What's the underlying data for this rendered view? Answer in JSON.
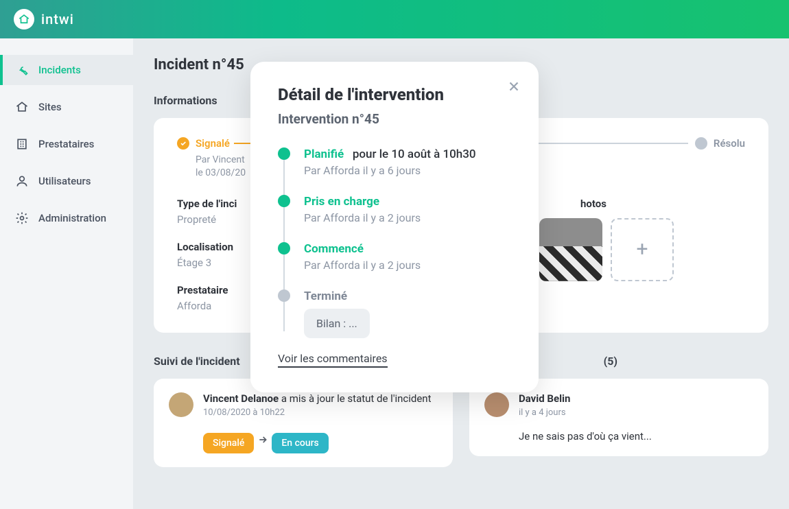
{
  "app": {
    "brand": "intwi"
  },
  "sidebar": {
    "items": [
      {
        "label": "Incidents",
        "icon": "wrench-icon",
        "active": true
      },
      {
        "label": "Sites",
        "icon": "home-icon",
        "active": false
      },
      {
        "label": "Prestataires",
        "icon": "building-icon",
        "active": false
      },
      {
        "label": "Utilisateurs",
        "icon": "user-icon",
        "active": false
      },
      {
        "label": "Administration",
        "icon": "gear-icon",
        "active": false
      }
    ]
  },
  "page": {
    "title": "Incident n°45",
    "informations_heading": "Informations"
  },
  "stepper": {
    "step1": {
      "label": "Signalé",
      "sub1": "Par Vincent",
      "sub2": "le 03/08/20"
    },
    "step_last": {
      "label": "Résolu"
    }
  },
  "info": {
    "type_label": "Type de l'inci",
    "type_value": "Propreté",
    "localisation_label": "Localisation",
    "localisation_value": "Étage 3",
    "prestataire_label": "Prestataire",
    "prestataire_value": "Afforda",
    "photos_label": "hotos"
  },
  "suivi": {
    "heading": "Suivi de l'incident",
    "actor": "Vincent Delanoe",
    "action": " a mis à jour le statut de l'incident",
    "time": "10/08/2020 à 10h22",
    "from": "Signalé",
    "to": "En cours"
  },
  "comments": {
    "heading": "(5)",
    "author": "David Belin",
    "time": "il y a 4 jours",
    "body": "Je ne sais pas d'où ça vient..."
  },
  "modal": {
    "title": "Détail de l'intervention",
    "subtitle": "Intervention n°45",
    "steps": [
      {
        "title": "Planifié",
        "extra": "pour le 10 août à 10h30",
        "sub": "Par Afforda il y a 6 jours",
        "done": true
      },
      {
        "title": "Pris en charge",
        "extra": "",
        "sub": "Par Afforda il y a 2 jours",
        "done": true
      },
      {
        "title": "Commencé",
        "extra": "",
        "sub": "Par Afforda il y a 2 jours",
        "done": true
      },
      {
        "title": "Terminé",
        "extra": "",
        "sub": "",
        "done": false
      }
    ],
    "bilan": "Bilan : ...",
    "link": "Voir les commentaires"
  }
}
